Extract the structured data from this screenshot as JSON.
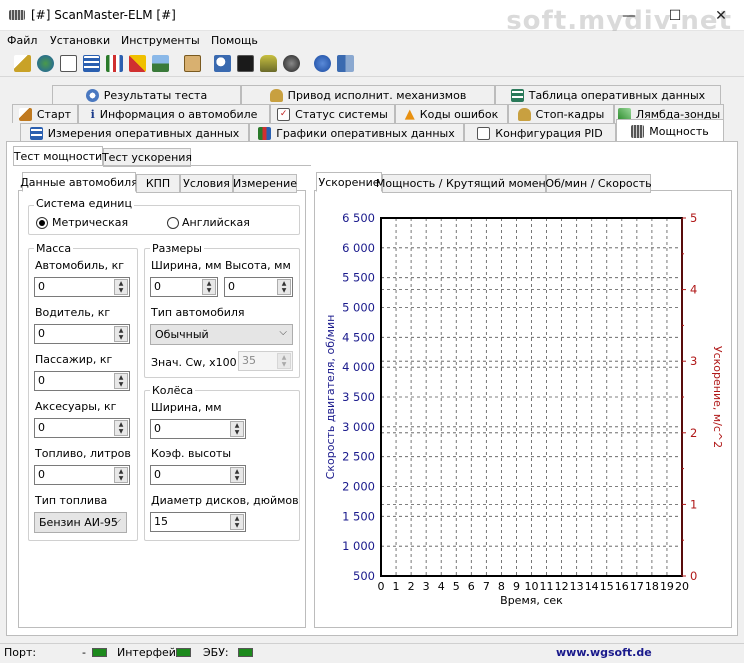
{
  "window": {
    "title": "[#] ScanMaster-ELM [#]",
    "minimize": "—",
    "maximize": "☐",
    "close": "✕",
    "watermark": "soft.mydiv.net"
  },
  "menu": [
    "Файл",
    "Установки",
    "Инструменты",
    "Помощь"
  ],
  "tabs": {
    "row1": [
      "Результаты теста",
      "Привод исполнит. механизмов",
      "Таблица оперативных данных"
    ],
    "row2": [
      "Старт",
      "Информация о автомобиле",
      "Статус системы",
      "Коды ошибок",
      "Стоп-кадры",
      "Лямбда-зонды"
    ],
    "row3": [
      "Измерения оперативных данных",
      "Графики оперативных данных",
      "Конфигурация PID",
      "Мощность"
    ]
  },
  "subtabs": [
    "Тест мощности",
    "Тест ускорения"
  ],
  "settings_tabs": [
    "Данные автомобиля",
    "КПП",
    "Условия",
    "Измерение"
  ],
  "units": {
    "title": "Система единиц",
    "metric": "Метрическая",
    "english": "Английская"
  },
  "mass": {
    "title": "Масса",
    "car_label": "Автомобиль, кг",
    "car_value": "0",
    "driver_label": "Водитель, кг",
    "driver_value": "0",
    "passenger_label": "Пассажир, кг",
    "passenger_value": "0",
    "accessories_label": "Аксесуары, кг",
    "accessories_value": "0",
    "fuel_label": "Топливо, литров",
    "fuel_value": "0",
    "fuel_type_label": "Тип топлива",
    "fuel_type_value": "Бензин АИ-95"
  },
  "dims": {
    "title": "Размеры",
    "width_label": "Ширина, мм",
    "width_value": "0",
    "height_label": "Высота, мм",
    "height_value": "0",
    "car_type_label": "Тип автомобиля",
    "car_type_value": "Обычный",
    "cw_label": "Знач. Cw, x100",
    "cw_value": "35"
  },
  "wheels": {
    "title": "Колёса",
    "width_label": "Ширина, мм",
    "width_value": "0",
    "ratio_label": "Коэф. высоты",
    "ratio_value": "0",
    "diameter_label": "Диаметр дисков, дюймов",
    "diameter_value": "15"
  },
  "chart_tabs": [
    "Ускорение",
    "Мощность / Крутящий момент",
    "Об/мин / Скорость"
  ],
  "chart_data": {
    "type": "line",
    "xlabel": "Время, сек",
    "ylabel": "Скорость двигателя, об/мин",
    "y2label": "Ускорение, м/с^2",
    "xlim": [
      0,
      20
    ],
    "ylim": [
      500,
      6500
    ],
    "y2lim": [
      0,
      5
    ],
    "xticks": [
      "0",
      "1",
      "2",
      "3",
      "4",
      "5",
      "6",
      "7",
      "8",
      "9",
      "10",
      "11",
      "12",
      "13",
      "14",
      "15",
      "16",
      "17",
      "18",
      "19",
      "20"
    ],
    "yticks": [
      "6 500",
      "6 000",
      "5 500",
      "5 000",
      "4 500",
      "4 000",
      "3 500",
      "3 000",
      "2 500",
      "2 000",
      "1 500",
      "1 000",
      "500"
    ],
    "y2ticks": [
      "5",
      "4",
      "3",
      "2",
      "1",
      "0"
    ],
    "grid": true,
    "series": [],
    "colors": {
      "left": "#1a1a8c",
      "right": "#b01818"
    }
  },
  "status": {
    "port_label": "Порт:",
    "port_value": "-",
    "iface_label": "Интерфейс:",
    "ecu_label": "ЭБУ:",
    "site": "www.wgsoft.de"
  }
}
